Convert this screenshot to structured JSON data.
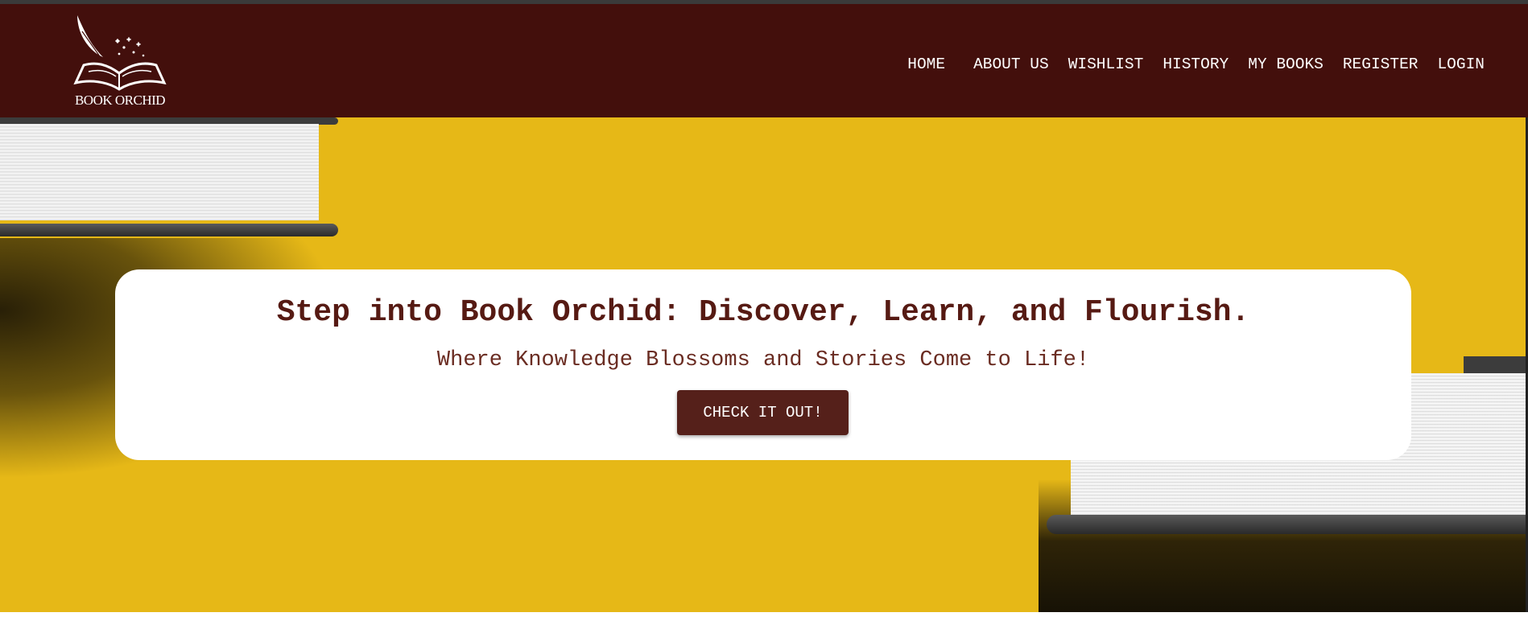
{
  "brand": {
    "name": "BOOK ORCHID",
    "logo_icon": "open-book-quill-icon"
  },
  "nav": {
    "items": [
      {
        "label": "HOME"
      },
      {
        "label": "ABOUT US"
      },
      {
        "label": "WISHLIST"
      },
      {
        "label": "HISTORY"
      },
      {
        "label": "MY BOOKS"
      },
      {
        "label": "REGISTER"
      },
      {
        "label": "LOGIN"
      }
    ]
  },
  "hero": {
    "title": "Step into Book Orchid: Discover, Learn, and Flourish.",
    "subtitle": "Where Knowledge Blossoms and Stories Come to Life!",
    "cta_label": "CHECK IT OUT!"
  },
  "colors": {
    "header_bg": "#430f0c",
    "hero_bg": "#e6b817",
    "accent": "#55201a",
    "headline": "#561a13"
  }
}
